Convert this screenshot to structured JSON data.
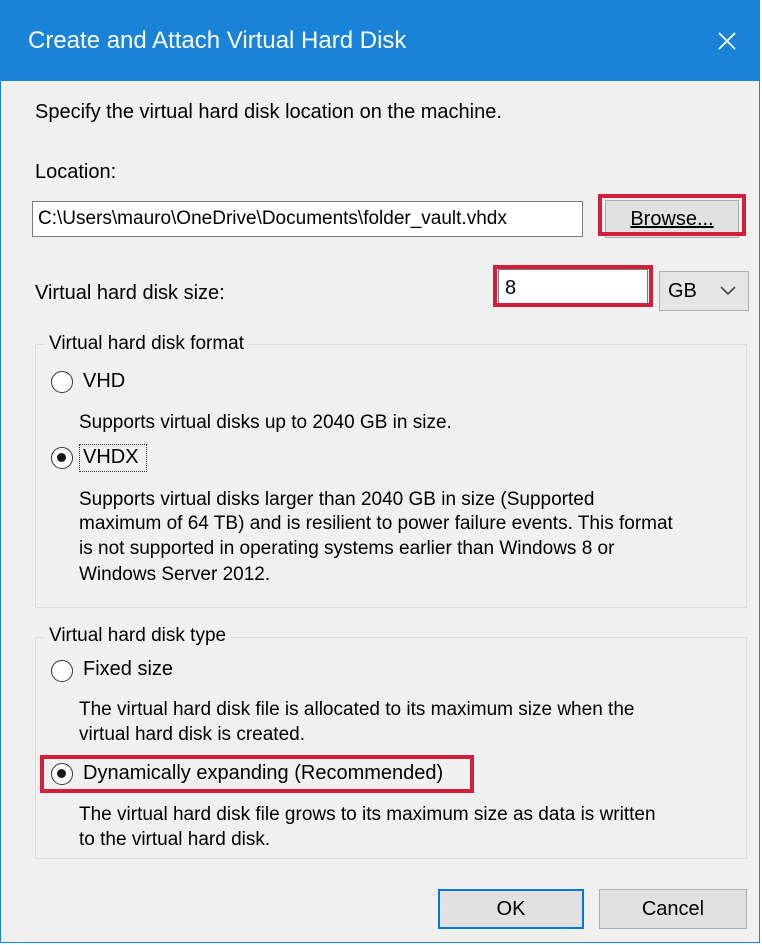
{
  "window": {
    "title": "Create and Attach Virtual Hard Disk"
  },
  "intro": "Specify the virtual hard disk location on the machine.",
  "location": {
    "label": "Location:",
    "value": "C:\\Users\\mauro\\OneDrive\\Documents\\folder_vault.vhdx",
    "browse_label": "Browse..."
  },
  "size": {
    "label": "Virtual hard disk size:",
    "value": "8",
    "unit": "GB"
  },
  "format": {
    "legend": "Virtual hard disk format",
    "options": [
      {
        "label": "VHD",
        "selected": false,
        "description": "Supports virtual disks up to 2040 GB in size."
      },
      {
        "label": "VHDX",
        "selected": true,
        "description_lines": [
          "Supports virtual disks larger than 2040 GB in size (Supported",
          "maximum of 64 TB) and is resilient to power failure events. This format",
          "is not supported in operating systems earlier than Windows 8 or",
          "Windows Server 2012."
        ]
      }
    ]
  },
  "type": {
    "legend": "Virtual hard disk type",
    "options": [
      {
        "label": "Fixed size",
        "selected": false,
        "description_lines": [
          "The virtual hard disk file is allocated to its maximum size when the",
          "virtual hard disk is created."
        ]
      },
      {
        "label": "Dynamically expanding (Recommended)",
        "selected": true,
        "description_lines": [
          "The virtual hard disk file grows to its maximum size as data is written",
          "to the virtual hard disk."
        ]
      }
    ]
  },
  "buttons": {
    "ok": "OK",
    "cancel": "Cancel"
  },
  "colors": {
    "titlebar": "#1883d7",
    "highlight": "#d21f3c"
  }
}
